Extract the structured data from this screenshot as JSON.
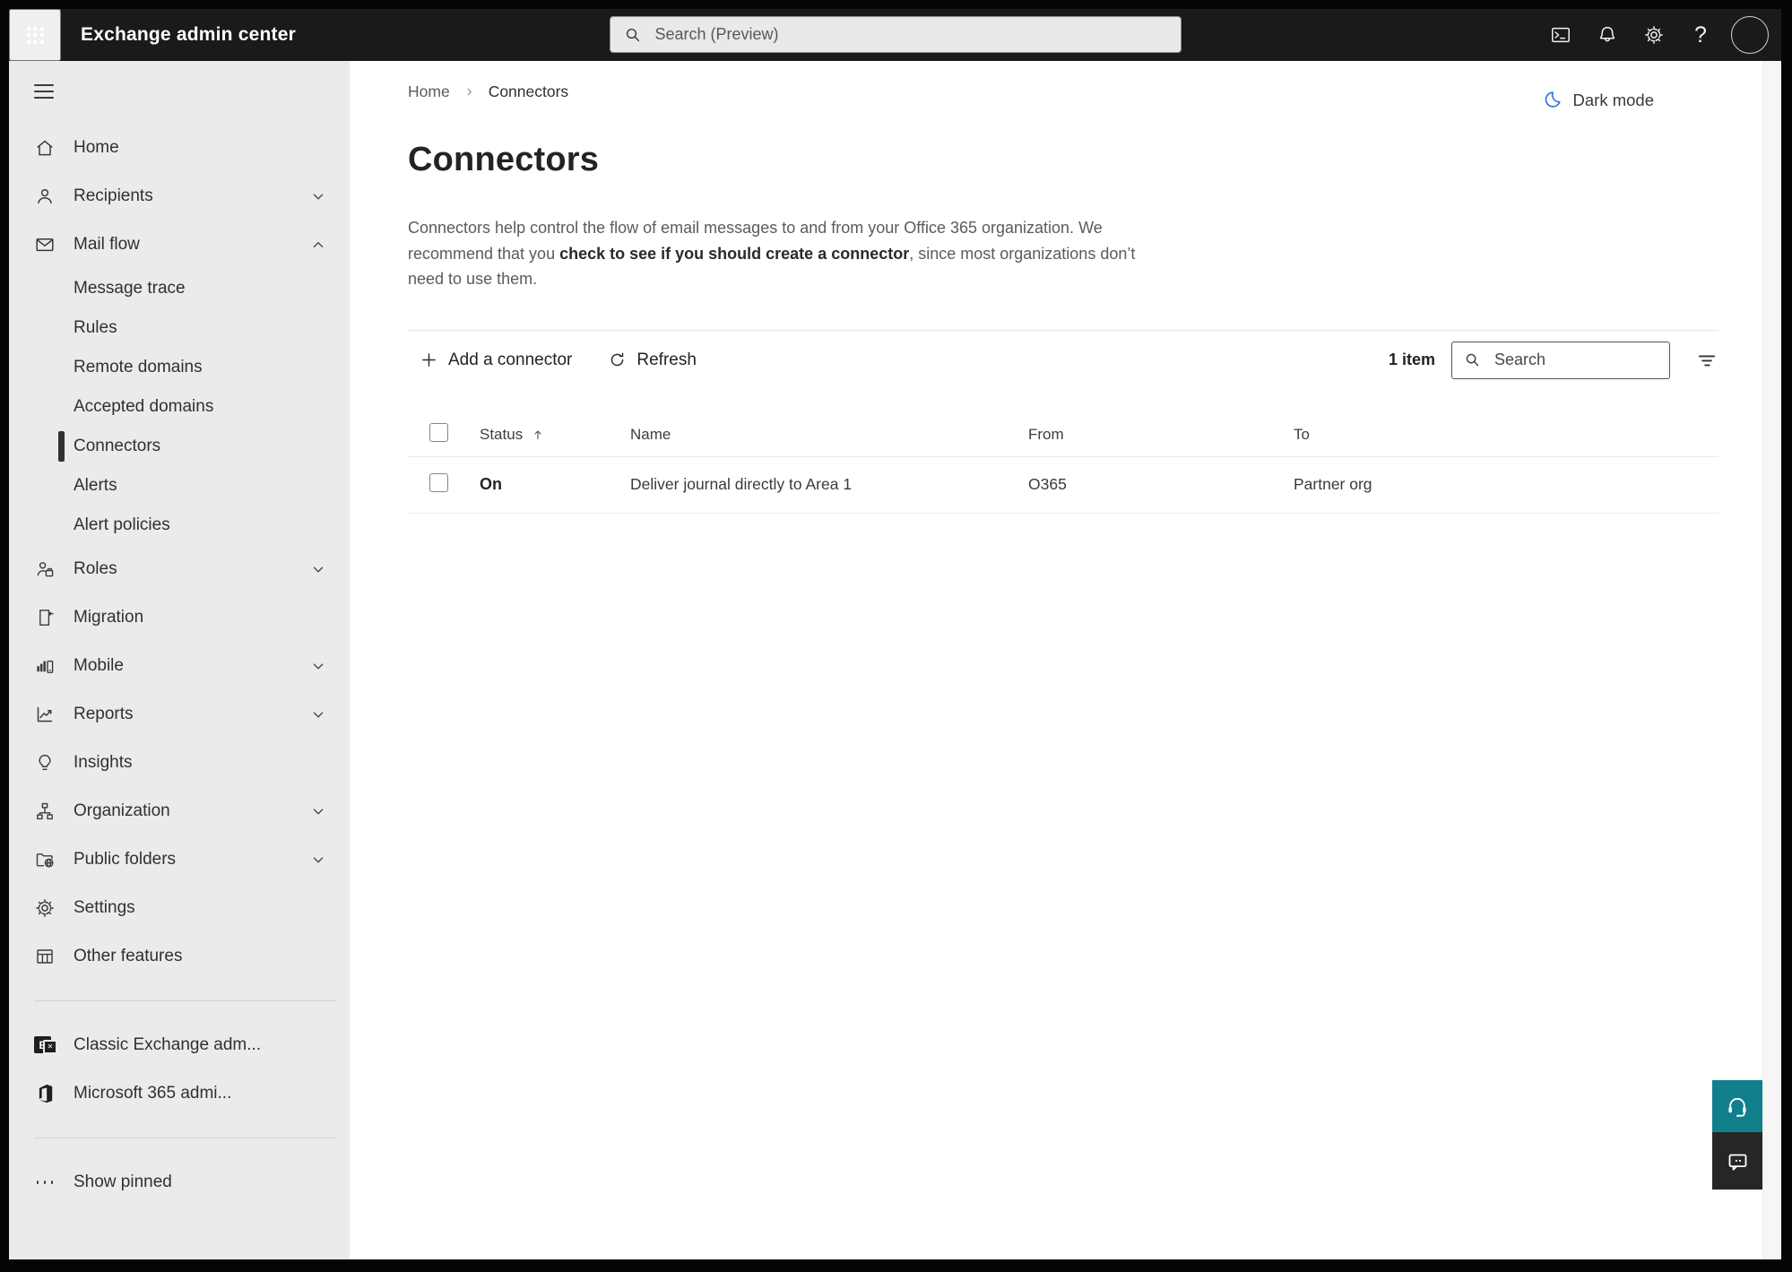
{
  "topbar": {
    "title": "Exchange admin center",
    "search_placeholder": "Search (Preview)",
    "help_glyph": "?",
    "icons": [
      "app-launcher-icon",
      "terminal-icon",
      "bell-icon",
      "gear-icon",
      "help-icon",
      "avatar"
    ]
  },
  "sidebar": {
    "items": [
      {
        "label": "Home",
        "icon": "home-icon"
      },
      {
        "label": "Recipients",
        "icon": "person-icon",
        "chevron": "down"
      },
      {
        "label": "Mail flow",
        "icon": "mail-icon",
        "chevron": "up",
        "expanded": true
      },
      {
        "label": "Message trace",
        "sub": true
      },
      {
        "label": "Rules",
        "sub": true
      },
      {
        "label": "Remote domains",
        "sub": true
      },
      {
        "label": "Accepted domains",
        "sub": true
      },
      {
        "label": "Connectors",
        "sub": true,
        "selected": true
      },
      {
        "label": "Alerts",
        "sub": true
      },
      {
        "label": "Alert policies",
        "sub": true
      },
      {
        "label": "Roles",
        "icon": "roles-icon",
        "chevron": "down"
      },
      {
        "label": "Migration",
        "icon": "migration-icon"
      },
      {
        "label": "Mobile",
        "icon": "mobile-icon",
        "chevron": "down"
      },
      {
        "label": "Reports",
        "icon": "reports-icon",
        "chevron": "down"
      },
      {
        "label": "Insights",
        "icon": "insights-icon"
      },
      {
        "label": "Organization",
        "icon": "organization-icon",
        "chevron": "down"
      },
      {
        "label": "Public folders",
        "icon": "public-folders-icon",
        "chevron": "down"
      },
      {
        "label": "Settings",
        "icon": "settings-icon"
      },
      {
        "label": "Other features",
        "icon": "other-features-icon"
      }
    ],
    "footer_items": [
      {
        "label": "Classic Exchange adm...",
        "icon": "classic-exchange-icon",
        "icon_letter": "E",
        "icon_badge": "✕"
      },
      {
        "label": "Microsoft 365 admi...",
        "icon": "microsoft-365-icon"
      }
    ],
    "show_pinned_label": "Show pinned",
    "show_pinned_icon": "ellipsis-icon"
  },
  "breadcrumb": {
    "home": "Home",
    "current": "Connectors"
  },
  "dark_mode": {
    "label": "Dark mode",
    "icon": "moon-icon"
  },
  "page": {
    "title": "Connectors",
    "intro_before": "Connectors help control the flow of email messages to and from your Office 365 organization. We recommend that you ",
    "intro_link": "check to see if you should create a connector",
    "intro_after": ", since most organizations don’t need to use them."
  },
  "toolbar": {
    "add_label": "Add a connector",
    "refresh_label": "Refresh",
    "item_count": "1 item",
    "search_placeholder": "Search"
  },
  "table": {
    "columns": {
      "status": "Status",
      "name": "Name",
      "from": "From",
      "to": "To"
    },
    "rows": [
      {
        "status": "On",
        "name": "Deliver journal directly to Area 1",
        "from": "O365",
        "to": "Partner org"
      }
    ]
  },
  "colors": {
    "topbar_bg": "#1a1a1a",
    "sidebar_bg": "#ebebeb",
    "moon_accent": "#2e71d3",
    "support_teal": "#11808c",
    "feedback_dark": "#272625"
  }
}
